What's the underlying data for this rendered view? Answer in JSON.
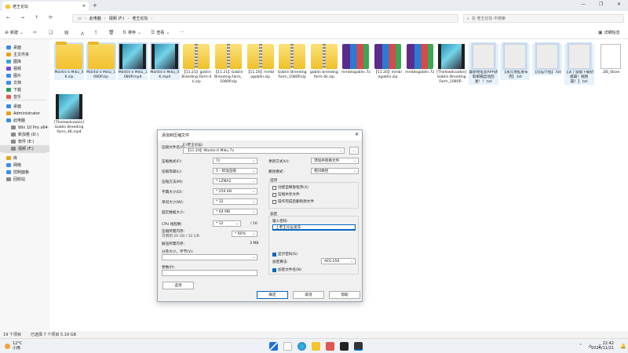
{
  "window": {
    "tab_title": "老王论坛",
    "new_tab": "+",
    "controls": [
      "—",
      "❐",
      "✕"
    ]
  },
  "address": {
    "crumbs": [
      "此电脑",
      "视频 (F:)",
      "老王论坛"
    ],
    "search_placeholder": "在 老王论坛 中搜索"
  },
  "toolbar": {
    "new": "新建",
    "sort": "排序",
    "view": "查看",
    "more": "···",
    "details": "详细信息"
  },
  "sidebar": {
    "items": [
      {
        "label": "桌面",
        "color": "#3a8ee6"
      },
      {
        "label": "主文件夹",
        "color": "#e3a21a"
      },
      {
        "label": "图库",
        "color": "#3aa6d8"
      },
      {
        "label": "视频",
        "color": "#7a4bd1"
      },
      {
        "label": "图片",
        "color": "#3a8ee6"
      },
      {
        "label": "文档",
        "color": "#3a8ee6"
      },
      {
        "label": "下载",
        "color": "#2a9d5c"
      },
      {
        "label": "音乐",
        "color": "#e0574f"
      },
      {
        "label": "桌面",
        "color": "#3a8ee6"
      },
      {
        "label": "Administrator",
        "color": "#e3a21a"
      },
      {
        "label": "此电脑",
        "color": "#3a8ee6"
      },
      {
        "label": "Win 10 Pro x64 (",
        "color": "#888888"
      },
      {
        "label": "新加卷 (D:)",
        "color": "#888888"
      },
      {
        "label": "软件 (E:)",
        "color": "#888888"
      },
      {
        "label": "视频 (F:)",
        "color": "#888888"
      },
      {
        "label": "库",
        "color": "#e3a21a"
      },
      {
        "label": "网络",
        "color": "#3a8ee6"
      },
      {
        "label": "控制面板",
        "color": "#3a8ee6"
      },
      {
        "label": "回收站",
        "color": "#888888"
      }
    ]
  },
  "files": [
    {
      "name": "Mantis-x Miku_4K.zip",
      "kind": "folder"
    },
    {
      "name": "Mantis-x Miku_1080P.zip",
      "kind": "folder"
    },
    {
      "name": "Mantis-x Miku_1080P.mp4",
      "kind": "video"
    },
    {
      "name": "Mantis-x Miku_4K.mp4",
      "kind": "video"
    },
    {
      "name": "【11.21】goblin Breeding Farm-4k.zip",
      "kind": "zip"
    },
    {
      "name": "【11.21】Goblin Breeding Farm_1080P.zip",
      "kind": "zip"
    },
    {
      "name": "【11.20】mmblogoblin.zip",
      "kind": "zip"
    },
    {
      "name": "Goblin Breeding Farm_1080P.zip",
      "kind": "zip"
    },
    {
      "name": "goblin breeding farm-4k.zip",
      "kind": "zip"
    },
    {
      "name": "mmblogoblin.7z",
      "kind": "rar"
    },
    {
      "name": "【11.20】mmblogoblin.zip",
      "kind": "rar"
    },
    {
      "name": "mmblogoblin.7z",
      "kind": "rar"
    },
    {
      "name": "[Thelewdcookie] Goblin Breeding Farm_1080P...",
      "kind": "video"
    },
    {
      "name": "最新地址及APP获取邮箱自动回复！！.txt",
      "kind": "txt"
    },
    {
      "name": "【永久地址发布页】.txt",
      "kind": "txt"
    },
    {
      "name": "【论坛介绍】.txt",
      "kind": "txt"
    },
    {
      "name": "【求了就能下载初级篇！视频篇！】.txt",
      "kind": "txt"
    },
    {
      "name": ".DS_Store",
      "kind": "blank"
    },
    {
      "name": "[Thelewdcookie] Goblin Breeding Farm_4K.mp4",
      "kind": "video"
    }
  ],
  "status": {
    "count": "19 个项目",
    "selected": "已选择 7 个项目  5.19 GB"
  },
  "taskbar": {
    "temp": "12°C",
    "weather": "小雨",
    "time": "22:42",
    "date": "2024/11/21"
  },
  "dialog": {
    "title": "添加到压缩文件",
    "archive_label": "压缩文件名(A)",
    "target_dir": "F:\\老王论坛\\",
    "archive_name": "【11.20】Mantis-X Miku.7z",
    "browse": "...",
    "format_label": "压缩格式(F):",
    "format_value": "7z",
    "level_label": "压缩等级(L):",
    "level_value": "5 - 标准压缩",
    "method_label": "压缩方法(M):",
    "method_value": "* LZMA2",
    "dict_label": "字典大小(D):",
    "dict_value": "* 256 KB",
    "word_label": "单词大小(W):",
    "word_value": "* 32",
    "solid_label": "固实数据大小:",
    "solid_value": "* 64 MB",
    "cpu_label": "CPU 线程数:",
    "cpu_value": "* 12",
    "cpu_total": "/ 16",
    "mem_label": "压缩所需内存:",
    "mem_sub": "可用到 26 GB / 32 GB",
    "mem_value": "* 80%",
    "mem_decomp_label": "解压所需内存:",
    "mem_decomp_value": "3 MB",
    "split_label": "分卷大小，字节(V):",
    "params_label": "参数(P):",
    "options_btn": "选项",
    "update_label": "更新方式(U):",
    "update_value": "添加并替换文件",
    "path_label": "路径模式:",
    "path_value": "相对路径",
    "options_title": "选项",
    "opt1": "创建自释放程序(X)",
    "opt2": "压缩共享文件",
    "opt3": "操作完成后删除源文件",
    "encrypt_title": "加密",
    "pwd_label": "输入密码:",
    "pwd_value": "上老王论坛发车",
    "show_pwd": "显示密码(S)",
    "enc_method_label": "加密算法:",
    "enc_method_value": "AES-256",
    "enc_names": "加密文件名(N)",
    "ok": "确定",
    "cancel": "取消",
    "help": "帮助"
  }
}
